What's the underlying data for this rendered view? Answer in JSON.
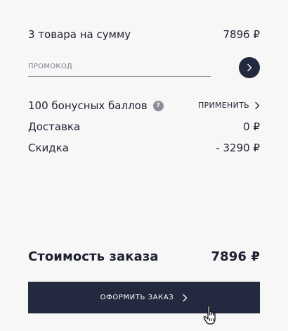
{
  "summary": {
    "items_label": "3 товара на сумму",
    "items_amount": "7896 ₽"
  },
  "promo": {
    "placeholder": "ПРОМОКОД",
    "value": "",
    "submit_icon": "chevron-right-icon"
  },
  "bonus": {
    "label": "100 бонусных баллов",
    "help_glyph": "?",
    "apply_label": "ПРИМЕНИТЬ"
  },
  "delivery": {
    "label": "Доставка",
    "amount": "0 ₽"
  },
  "discount": {
    "label": "Скидка",
    "amount": "- 3290 ₽"
  },
  "total": {
    "label": "Стоимость заказа",
    "amount": "7896 ₽"
  },
  "checkout": {
    "label": "ОФОРМИТЬ ЗАКАЗ"
  },
  "colors": {
    "background": "#f7f7f8",
    "primary": "#23293f",
    "text": "#1d2130",
    "muted": "#8b8e98"
  }
}
